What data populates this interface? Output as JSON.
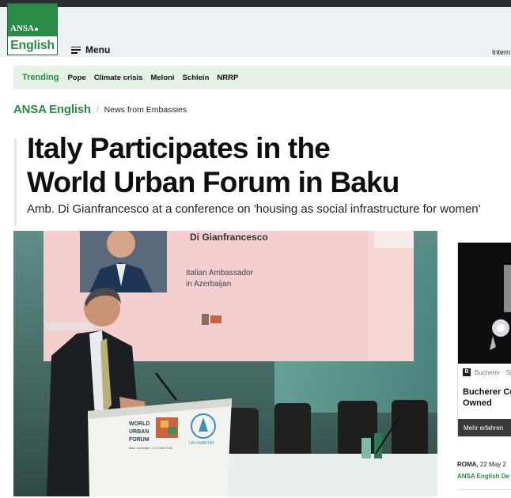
{
  "header": {
    "logo_top": "ANSA",
    "logo_bottom": "English",
    "menu_label": "Menu",
    "international": "Intern"
  },
  "trending": {
    "label": "Trending",
    "items": [
      "Pope",
      "Climate crisis",
      "Meloni",
      "Schlein",
      "NRRP"
    ]
  },
  "breadcrumb": {
    "home": "ANSA English",
    "separator": "/",
    "section": "News from Embassies"
  },
  "article": {
    "title_line1": "Italy Participates in the",
    "title_line2": "World Urban Forum in Baku",
    "subtitle": "Amb. Di Gianfrancesco at a conference on 'housing as social infrastructure for women'"
  },
  "photo": {
    "screen_name": "Di Gianfrancesco",
    "screen_role_line1": "Italian Ambassador",
    "screen_role_line2": "in Azerbaijan",
    "screen_logo_text": "WORLD URBAN FORUM",
    "podium_line1": "WORLD",
    "podium_line2": "URBAN",
    "podium_line3": "FORUM",
    "podium_small": "Baku, Azerbaijan | 17-22 MAY 2026",
    "podium_unhabitat": "UN-HABITAT"
  },
  "ad": {
    "brand": "Bucherer · Sp",
    "badge": "B",
    "title_line1": "Bucherer Ce",
    "title_line2": "Owned",
    "cta": "Mehr erfahren"
  },
  "dateline": {
    "place": "ROMA,",
    "date": "22 May 2",
    "byline": "ANSA English De"
  },
  "colors": {
    "brand_green": "#2a8b48",
    "trending_bg": "#e6f2e6",
    "header_bg": "#eef1f3",
    "top_strip": "#2a2e33"
  }
}
